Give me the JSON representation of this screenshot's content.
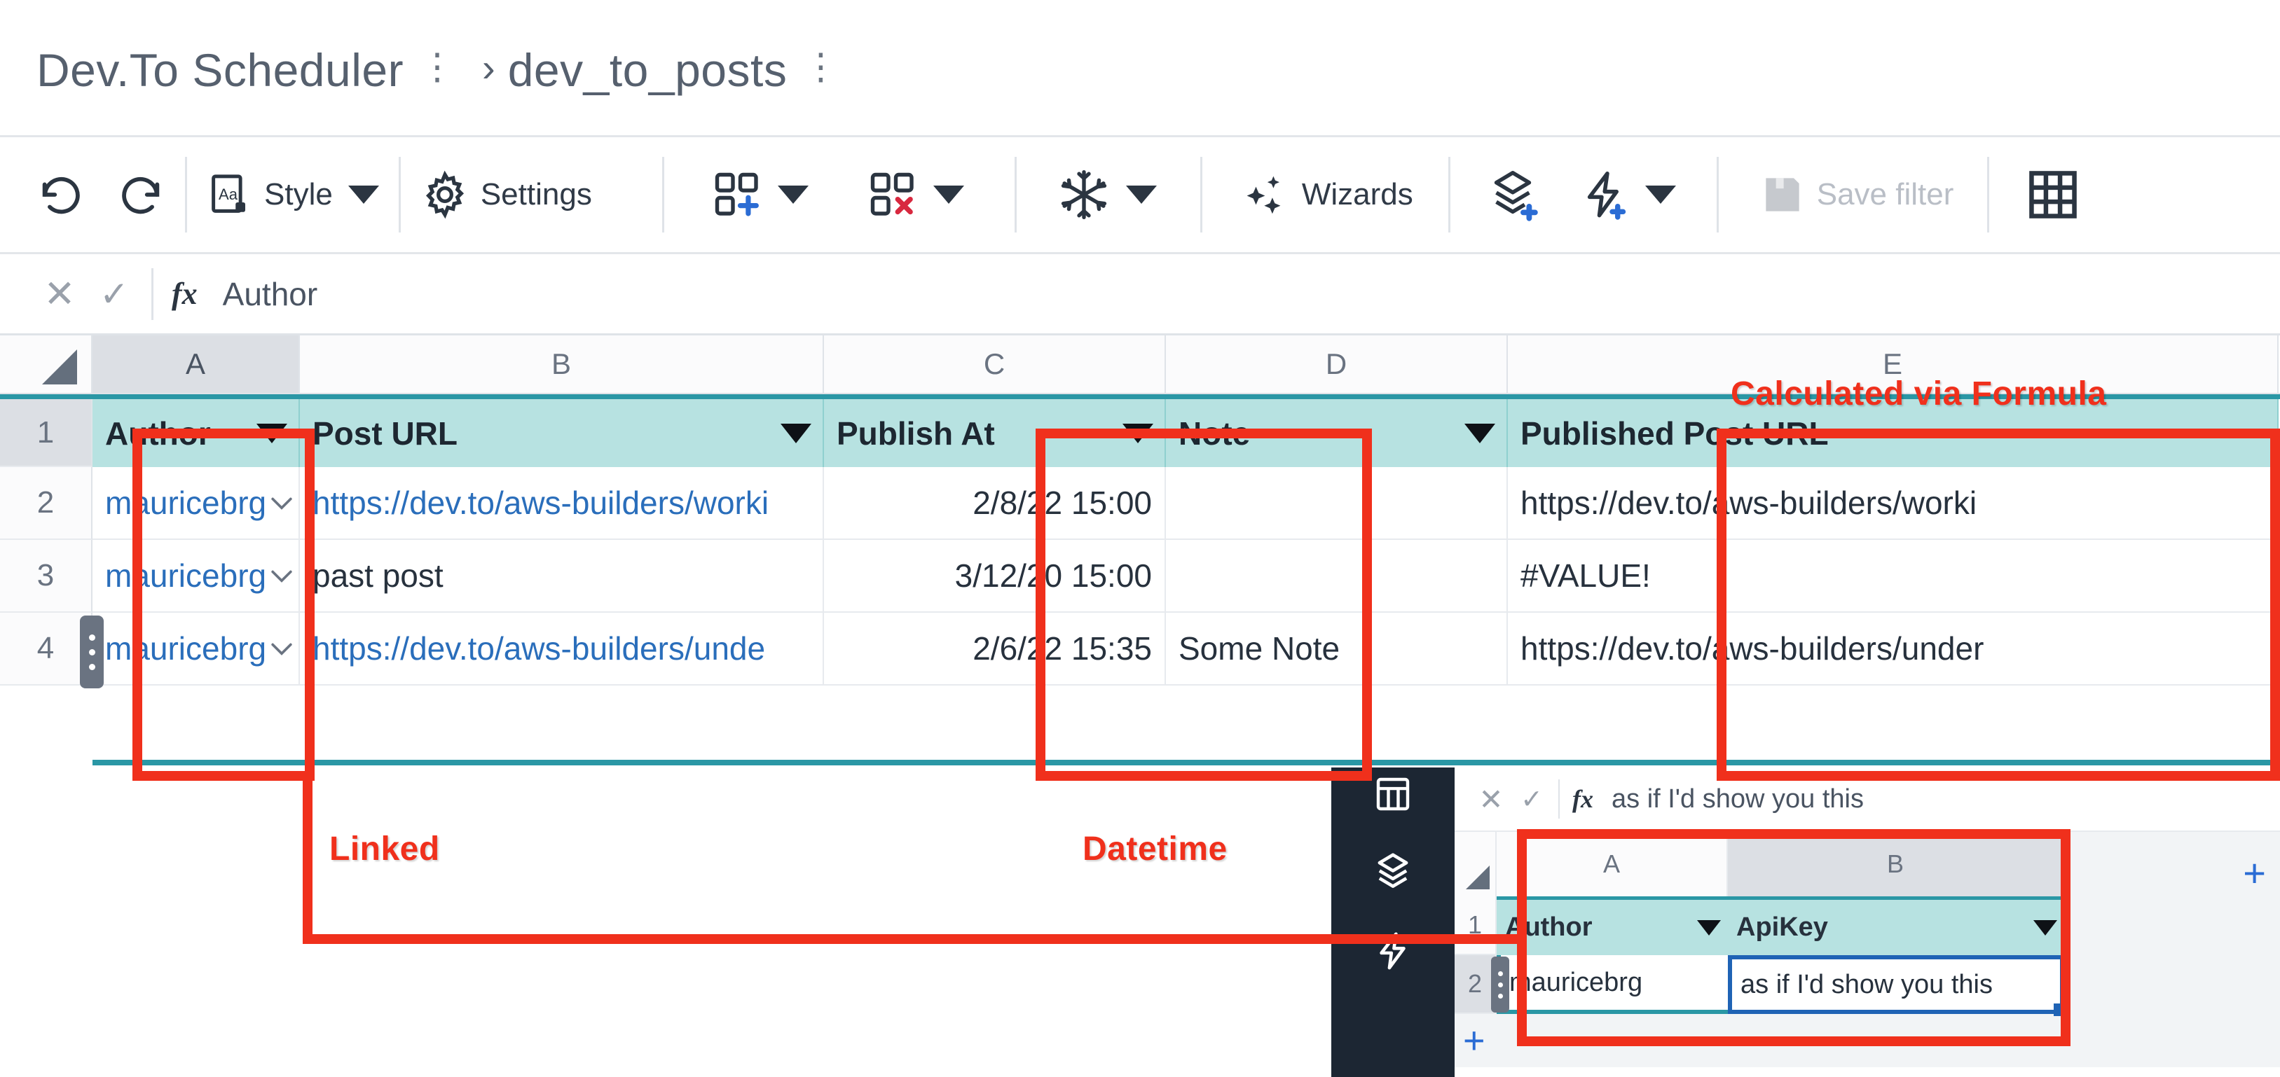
{
  "breadcrumb": {
    "workbook": "Dev.To Scheduler",
    "menu_dots": "⋮",
    "separator": "›",
    "sheet": "dev_to_posts",
    "sheet_menu_dots": "⋮"
  },
  "toolbar": {
    "undo_label": "undo",
    "redo_label": "redo",
    "style_label": "Style",
    "settings_label": "Settings",
    "insert_cells_label": "insert-cells",
    "delete_cells_label": "delete-cells",
    "freeze_label": "freeze",
    "wizards_label": "Wizards",
    "add_layer_label": "add-layer",
    "add_action_label": "add-action",
    "save_filter_label": "Save filter",
    "grid_view_label": "grid-view"
  },
  "formula_bar": {
    "cancel": "✕",
    "confirm": "✓",
    "fx": "fx",
    "value": "Author"
  },
  "grid": {
    "columns": [
      "A",
      "B",
      "C",
      "D",
      "E"
    ],
    "selected_column": "A",
    "row_numbers": [
      "1",
      "2",
      "3",
      "4"
    ],
    "selected_row": "1",
    "headers": [
      "Author",
      "Post URL",
      "Publish At",
      "Note",
      "Published Post URL"
    ],
    "rows": [
      {
        "num": "2",
        "author": "mauricebrg",
        "post_url": "https://dev.to/aws-builders/worki",
        "publish_at": "2/8/22 15:00",
        "note": "",
        "published_post_url": "https://dev.to/aws-builders/worki"
      },
      {
        "num": "3",
        "author": "mauricebrg",
        "post_url": "past post",
        "publish_at": "3/12/20 15:00",
        "note": "",
        "published_post_url": "#VALUE!"
      },
      {
        "num": "4",
        "author": "mauricebrg",
        "post_url": "https://dev.to/aws-builders/unde",
        "publish_at": "2/6/22 15:35",
        "note": "Some Note",
        "published_post_url": "https://dev.to/aws-builders/under"
      }
    ]
  },
  "annotations": {
    "linked": "Linked",
    "datetime": "Datetime",
    "calculated": "Calculated via Formula"
  },
  "inset": {
    "sidebar_icons": [
      "grid-icon",
      "layers-icon",
      "lightning-icon"
    ],
    "formula_bar": {
      "cancel": "✕",
      "confirm": "✓",
      "fx": "fx",
      "value": "as if I'd show you this"
    },
    "columns": [
      "A",
      "B"
    ],
    "selected_column": "B",
    "row_numbers": [
      "1",
      "2"
    ],
    "headers": [
      "Author",
      "ApiKey"
    ],
    "rows": [
      {
        "num": "2",
        "author": "mauricebrg",
        "apikey": "as if I'd show you this"
      }
    ],
    "add_row_label": "+",
    "add_column_label": "+"
  },
  "colors": {
    "annotation_red": "#f0301c",
    "header_teal": "#b7e2e1",
    "header_teal_border": "#2a97a5",
    "link_blue": "#2a6ebb",
    "selection_blue": "#1f63b5",
    "sidebar_navy": "#1c2633",
    "accent_blue": "#2b6cd4",
    "delete_red": "#d8283f"
  }
}
